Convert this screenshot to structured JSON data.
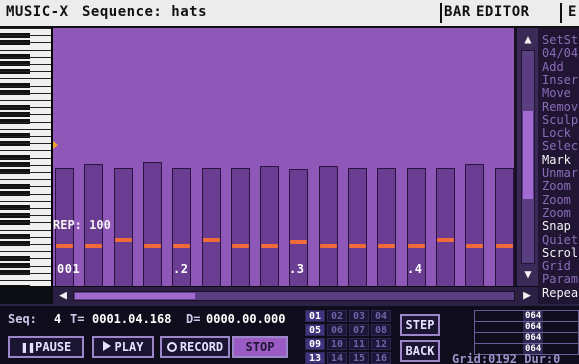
{
  "titlebar": {
    "app": "MUSIC-X",
    "sequence": "Sequence: hats",
    "bar": "BAR",
    "editor": "EDITOR",
    "extra": "E"
  },
  "grid": {
    "rep_label": "REP: 100",
    "position_labels": [
      "001",
      ".2",
      ".3",
      ".4"
    ],
    "colors": {
      "background": "#9a5cc4",
      "column": "#6a3d92",
      "velocity": "#ef6b3a"
    }
  },
  "menu": {
    "items": [
      {
        "label": "SetSt",
        "bright": false
      },
      {
        "label": "04/04",
        "bright": false
      },
      {
        "label": "Add",
        "bright": false
      },
      {
        "label": "Insert",
        "bright": false
      },
      {
        "label": "Move",
        "bright": false
      },
      {
        "label": "Remove",
        "bright": false
      },
      {
        "label": "Sculpt",
        "bright": false
      },
      {
        "label": "Lock",
        "bright": false
      },
      {
        "label": "Select",
        "bright": false
      },
      {
        "label": "Mark",
        "bright": true
      },
      {
        "label": "Unmark",
        "bright": false
      },
      {
        "label": "Zoom",
        "bright": false
      },
      {
        "label": "Zoom",
        "bright": false
      },
      {
        "label": "Zoom",
        "bright": false
      },
      {
        "label": "Snap",
        "bright": true
      },
      {
        "label": "Quiet",
        "bright": false
      },
      {
        "label": "Scroll",
        "bright": true
      },
      {
        "label": "Grid",
        "bright": false
      },
      {
        "label": "Param",
        "bright": false
      },
      {
        "label": "Repeat",
        "bright": true
      }
    ]
  },
  "status": {
    "seq_label": "Seq:",
    "seq_value": "4",
    "t_label": "T=",
    "t_value": "0001.04.168",
    "d_label": "D=",
    "d_value": "0000.00.000",
    "grid_text": "Grid:0192  Dur:0"
  },
  "transport": {
    "pause": "PAUSE",
    "play": "PLAY",
    "record": "RECORD",
    "stop": "STOP"
  },
  "numbers": {
    "cells": [
      "01",
      "02",
      "03",
      "04",
      "05",
      "06",
      "07",
      "08",
      "09",
      "10",
      "11",
      "12",
      "13",
      "14",
      "15",
      "16"
    ],
    "active": [
      "01",
      "05",
      "09",
      "13"
    ]
  },
  "side_buttons": {
    "step": "STEP",
    "back": "BACK"
  },
  "channels": {
    "values": [
      "064",
      "064",
      "064",
      "064"
    ]
  },
  "icons": {
    "scroll_up": "arrow-up-icon",
    "scroll_down": "arrow-down-icon",
    "scroll_left": "arrow-left-icon",
    "scroll_right": "arrow-right-icon",
    "pause": "pause-icon",
    "play": "play-icon",
    "record": "record-icon"
  }
}
